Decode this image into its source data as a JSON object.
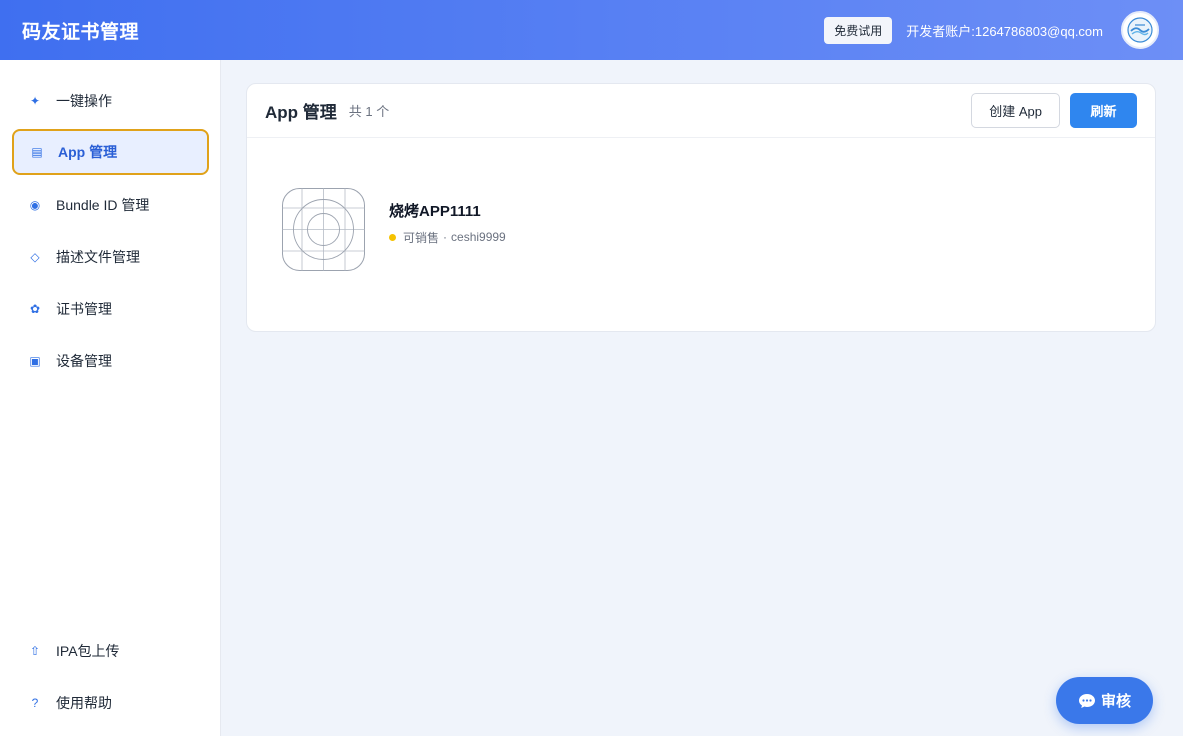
{
  "header": {
    "brand": "码友证书管理",
    "trial_label": "免费试用",
    "account": "开发者账户:1264786803@qq.com",
    "avatar_icon": "logo-avatar-icon"
  },
  "sidebar": {
    "items": [
      {
        "label": "一键操作",
        "icon": "sparkle-icon",
        "active": false
      },
      {
        "label": "App 管理",
        "icon": "list-icon",
        "active": true
      },
      {
        "label": "Bundle ID 管理",
        "icon": "target-icon",
        "active": false
      },
      {
        "label": "描述文件管理",
        "icon": "diamond-icon",
        "active": false
      },
      {
        "label": "证书管理",
        "icon": "flower-icon",
        "active": false
      },
      {
        "label": "设备管理",
        "icon": "device-icon",
        "active": false
      }
    ],
    "bottom_items": [
      {
        "label": "IPA包上传",
        "icon": "upload-icon"
      },
      {
        "label": "使用帮助",
        "icon": "question-icon"
      }
    ]
  },
  "main": {
    "title": "App 管理",
    "count": "共 1 个",
    "create_label": "创建 App",
    "refresh_label": "刷新",
    "apps": [
      {
        "name": "烧烤APP1111",
        "status": "可销售",
        "separator": "·",
        "bundle": "ceshi9999",
        "status_color": "#f5c200"
      }
    ]
  },
  "fab": {
    "label": "审核",
    "icon": "chat-bubble-icon"
  },
  "colors": {
    "header_start": "#3f6ff0",
    "header_end": "#6d8ff6",
    "primary": "#2f86ef",
    "active_border": "#e0a21a",
    "active_bg": "#e8efff"
  }
}
